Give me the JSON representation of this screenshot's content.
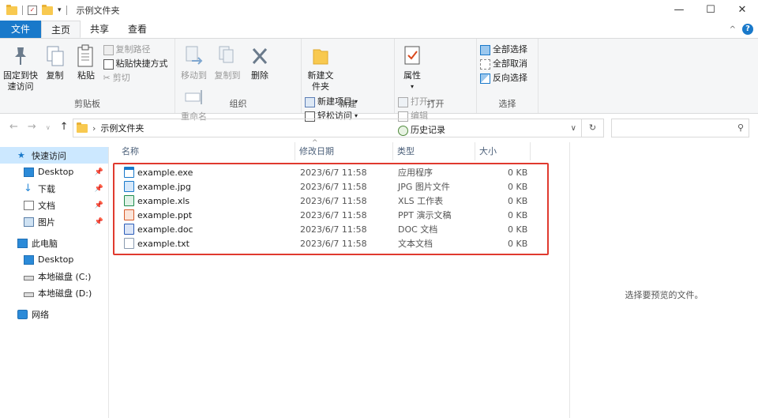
{
  "window": {
    "title": "示例文件夹",
    "controls": [
      "—",
      "☐",
      "✕"
    ]
  },
  "tabs": [
    "文件",
    "主页",
    "共享",
    "查看"
  ],
  "ribbon": {
    "clipboard": {
      "pin": "固定到快速访问",
      "copy": "复制",
      "paste": "粘贴",
      "copy_path": "复制路径",
      "paste_shortcut": "粘贴快捷方式",
      "cut": "剪切",
      "label": "剪贴板"
    },
    "organize": {
      "move_to": "移动到",
      "copy_to": "复制到",
      "delete": "删除",
      "rename": "重命名",
      "label": "组织"
    },
    "new": {
      "new_folder": "新建文件夹",
      "new_item": "新建项目",
      "easy_access": "轻松访问",
      "label": "新建"
    },
    "open": {
      "properties": "属性",
      "open": "打开",
      "edit": "编辑",
      "history": "历史记录",
      "label": "打开"
    },
    "select": {
      "select_all": "全部选择",
      "select_none": "全部取消",
      "invert": "反向选择",
      "label": "选择"
    }
  },
  "address": {
    "path": "示例文件夹"
  },
  "nav": {
    "quick_access": "快速访问",
    "items": [
      {
        "label": "Desktop",
        "pinned": true
      },
      {
        "label": "下载",
        "pinned": true
      },
      {
        "label": "文档",
        "pinned": true
      },
      {
        "label": "图片",
        "pinned": true
      }
    ],
    "this_pc": "此电脑",
    "pc_items": [
      "Desktop",
      "本地磁盘 (C:)",
      "本地磁盘 (D:)"
    ],
    "network": "网络"
  },
  "columns": [
    "名称",
    "修改日期",
    "类型",
    "大小"
  ],
  "files": [
    {
      "name": "example.exe",
      "date": "2023/6/7 11:58",
      "type": "应用程序",
      "size": "0 KB",
      "icon": "exe-icon"
    },
    {
      "name": "example.jpg",
      "date": "2023/6/7 11:58",
      "type": "JPG 图片文件",
      "size": "0 KB",
      "icon": "jpg-icon"
    },
    {
      "name": "example.xls",
      "date": "2023/6/7 11:58",
      "type": "XLS 工作表",
      "size": "0 KB",
      "icon": "xls-icon"
    },
    {
      "name": "example.ppt",
      "date": "2023/6/7 11:58",
      "type": "PPT 演示文稿",
      "size": "0 KB",
      "icon": "ppt-icon"
    },
    {
      "name": "example.doc",
      "date": "2023/6/7 11:58",
      "type": "DOC 文档",
      "size": "0 KB",
      "icon": "doc-icon"
    },
    {
      "name": "example.txt",
      "date": "2023/6/7 11:58",
      "type": "文本文档",
      "size": "0 KB",
      "icon": "txt-icon"
    }
  ],
  "preview": {
    "empty_text": "选择要预览的文件。"
  },
  "colors": {
    "accent": "#1979ca",
    "highlight_border": "#e03a2f",
    "selection": "#cce8ff"
  }
}
